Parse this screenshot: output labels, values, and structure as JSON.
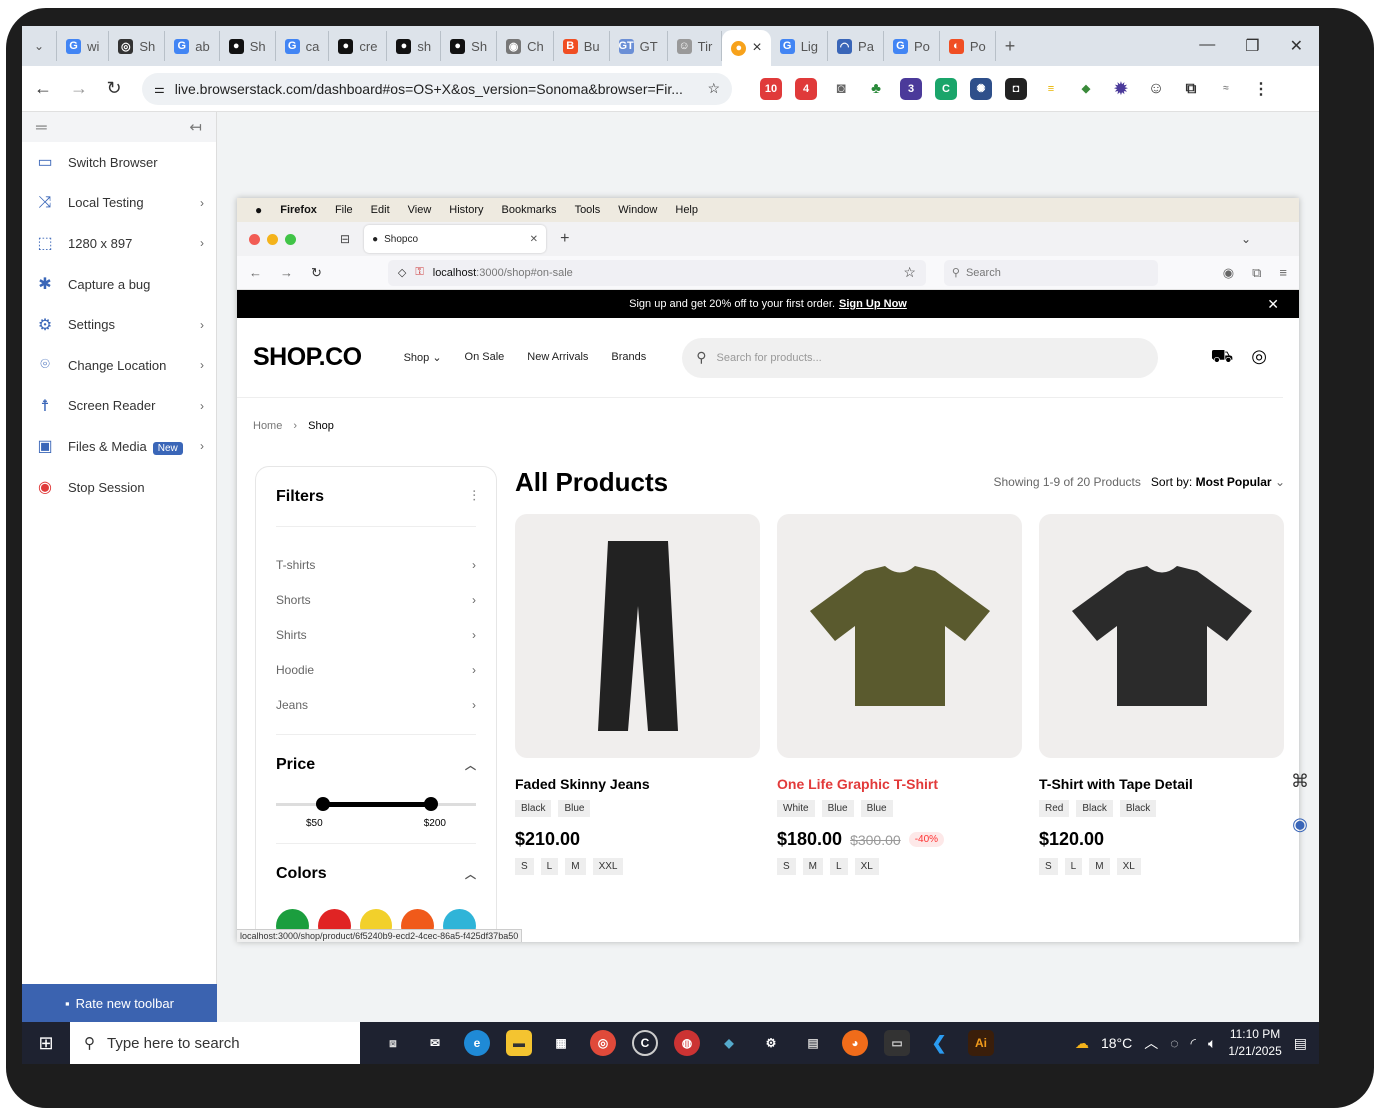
{
  "chrome": {
    "tabs": [
      {
        "label": "wi",
        "icon": "G",
        "color": "#4285f4"
      },
      {
        "label": "Sh",
        "icon": "◎",
        "color": "#333"
      },
      {
        "label": "ab",
        "icon": "G",
        "color": "#4285f4"
      },
      {
        "label": "Sh",
        "icon": "●",
        "color": "#111"
      },
      {
        "label": "ca",
        "icon": "G",
        "color": "#4285f4"
      },
      {
        "label": "cre",
        "icon": "●",
        "color": "#111"
      },
      {
        "label": "sh",
        "icon": "●",
        "color": "#111"
      },
      {
        "label": "Sh",
        "icon": "●",
        "color": "#111"
      },
      {
        "label": "Ch",
        "icon": "◉",
        "color": "#777"
      },
      {
        "label": "Bu",
        "icon": "B",
        "color": "#f04e23"
      },
      {
        "label": "GT",
        "icon": "GT",
        "color": "#6b8fd6"
      },
      {
        "label": "Tir",
        "icon": "☺",
        "color": "#999"
      }
    ],
    "active_tab_close": "×",
    "tabs_after": [
      {
        "label": "Lig",
        "icon": "G",
        "color": "#4285f4"
      },
      {
        "label": "Pa",
        "icon": "◠",
        "color": "#3a66b8"
      },
      {
        "label": "Po",
        "icon": "G",
        "color": "#4285f4"
      },
      {
        "label": "Po",
        "icon": "◐",
        "color": "#f04e23"
      }
    ],
    "new_tab": "+",
    "url": "live.browserstack.com/dashboard#os=OS+X&os_version=Sonoma&browser=Fir..."
  },
  "sidebar": {
    "items": [
      {
        "label": "Switch Browser",
        "icon": "▭",
        "chevron": ""
      },
      {
        "label": "Local Testing",
        "icon": "⤨",
        "chevron": "›"
      },
      {
        "label": "1280 x 897",
        "icon": "⬚",
        "chevron": "›"
      },
      {
        "label": "Capture a bug",
        "icon": "✱",
        "chevron": ""
      },
      {
        "label": "Settings",
        "icon": "⚙",
        "chevron": "›"
      },
      {
        "label": "Change Location",
        "icon": "⌾",
        "chevron": "›"
      },
      {
        "label": "Screen Reader",
        "icon": "☨",
        "chevron": "›"
      },
      {
        "label": "Files & Media",
        "icon": "▣",
        "chevron": "›",
        "badge": "New"
      },
      {
        "label": "Stop Session",
        "icon": "◉",
        "chevron": ""
      }
    ],
    "rate": "Rate new toolbar"
  },
  "mac": {
    "menu": [
      "Firefox",
      "File",
      "Edit",
      "View",
      "History",
      "Bookmarks",
      "Tools",
      "Window",
      "Help"
    ],
    "tab_title": "Shopco",
    "url_host": "localhost",
    "url_path": ":3000/shop#on-sale",
    "search_placeholder": "Search",
    "status_url": "localhost:3000/shop/product/6f5240b9-ecd2-4cec-86a5-f425df37ba50"
  },
  "shop": {
    "promo_text": "Sign up and get 20% off to your first order.",
    "promo_link": "Sign Up Now",
    "logo": "SHOP.CO",
    "nav": [
      "Shop ⌄",
      "On Sale",
      "New Arrivals",
      "Brands"
    ],
    "search_placeholder": "Search for products...",
    "crumb_home": "Home",
    "crumb_sep": "›",
    "crumb_current": "Shop",
    "filters_title": "Filters",
    "categories": [
      "T-shirts",
      "Shorts",
      "Shirts",
      "Hoodie",
      "Jeans"
    ],
    "price_title": "Price",
    "price_min": "$50",
    "price_max": "$200",
    "colors_title": "Colors",
    "color_swatches": [
      "#1b9e3e",
      "#e02424",
      "#f2d02b",
      "#f05a1a",
      "#2fb4d8"
    ],
    "products_title": "All Products",
    "showing": "Showing 1-9 of 20 Products",
    "sort_label": "Sort by:",
    "sort_value": "Most Popular",
    "products": [
      {
        "name": "Faded Skinny Jeans",
        "tags": [
          "Black",
          "Blue"
        ],
        "price": "$210.00",
        "old": "",
        "disc": "",
        "sizes": [
          "S",
          "L",
          "M",
          "XXL"
        ],
        "name_color": "#000",
        "garment": "#222"
      },
      {
        "name": "One Life Graphic T-Shirt",
        "tags": [
          "White",
          "Blue",
          "Blue"
        ],
        "price": "$180.00",
        "old": "$300.00",
        "disc": "-40%",
        "sizes": [
          "S",
          "M",
          "L",
          "XL"
        ],
        "name_color": "#e23a3a",
        "garment": "#5a5a2e"
      },
      {
        "name": "T-Shirt with Tape Detail",
        "tags": [
          "Red",
          "Black",
          "Black"
        ],
        "price": "$120.00",
        "old": "",
        "disc": "",
        "sizes": [
          "S",
          "L",
          "M",
          "XL"
        ],
        "name_color": "#000",
        "garment": "#2b2b2b"
      }
    ]
  },
  "taskbar": {
    "search_placeholder": "Type here to search",
    "weather": "18°C",
    "time": "11:10 PM",
    "date": "1/21/2025"
  }
}
